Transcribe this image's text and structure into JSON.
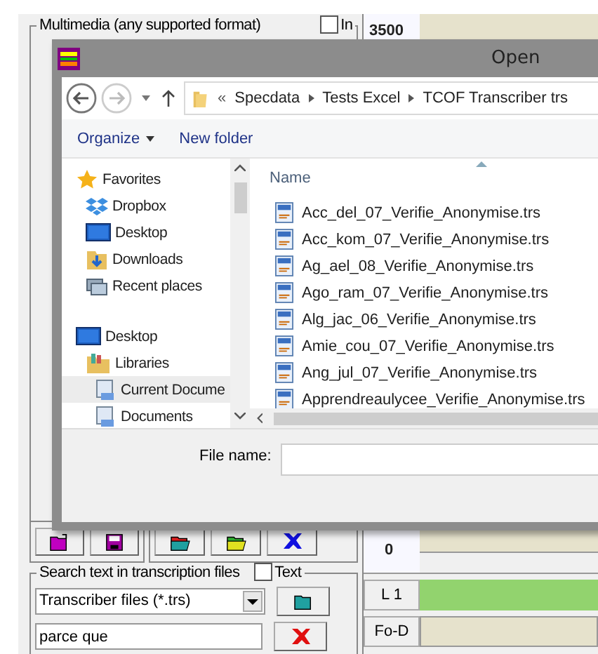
{
  "multimedia_group": {
    "label": "Multimedia (any supported format)",
    "checkbox": {
      "label": "In",
      "checked": false
    }
  },
  "ruler": {
    "top_value": "3500",
    "bottom_value": "0"
  },
  "dialog": {
    "title": "Open",
    "breadcrumb": {
      "overflow": "«",
      "parts": [
        "Specdata",
        "Tests Excel",
        "TCOF Transcriber trs"
      ]
    },
    "commands": [
      {
        "label": "Organize",
        "menu": true
      },
      {
        "label": "New folder",
        "menu": false
      }
    ],
    "nav_items": [
      {
        "label": "Favorites",
        "kind": "star",
        "selected": false,
        "children": [
          {
            "label": "Dropbox",
            "kind": "dropbox",
            "selected": false
          },
          {
            "label": "Desktop",
            "kind": "desktop",
            "selected": false
          },
          {
            "label": "Downloads",
            "kind": "downloads",
            "selected": false
          },
          {
            "label": "Recent places",
            "kind": "recent",
            "selected": false
          }
        ]
      },
      {
        "label": "Desktop",
        "kind": "desktop",
        "selected": false,
        "children": [
          {
            "label": "Libraries",
            "kind": "libraries",
            "selected": false,
            "children": [
              {
                "label": "Current Docume",
                "kind": "document",
                "selected": true
              },
              {
                "label": "Documents",
                "kind": "document",
                "selected": false
              }
            ]
          }
        ]
      }
    ],
    "column_header": "Name",
    "files": [
      "Acc_del_07_Verifie_Anonymise.trs",
      "Acc_kom_07_Verifie_Anonymise.trs",
      "Ag_ael_08_Verifie_Anonymise.trs",
      "Ago_ram_07_Verifie_Anonymise.trs",
      "Alg_jac_06_Verifie_Anonymise.trs",
      "Amie_cou_07_Verifie_Anonymise.trs",
      "Ang_jul_07_Verifie_Anonymise.trs",
      "Apprendreaulycee_Verifie_Anonymise.trs"
    ],
    "file_name_label": "File name:"
  },
  "tracks": [
    {
      "label": "L 1",
      "kind": "bar"
    },
    {
      "label": "Fo-D",
      "kind": "grid"
    }
  ],
  "search_group": {
    "label": "Search text in transcription files",
    "checkbox": {
      "label": "Text",
      "checked": false
    },
    "file_type": "Transcriber files (*.trs)",
    "query": "parce que"
  }
}
